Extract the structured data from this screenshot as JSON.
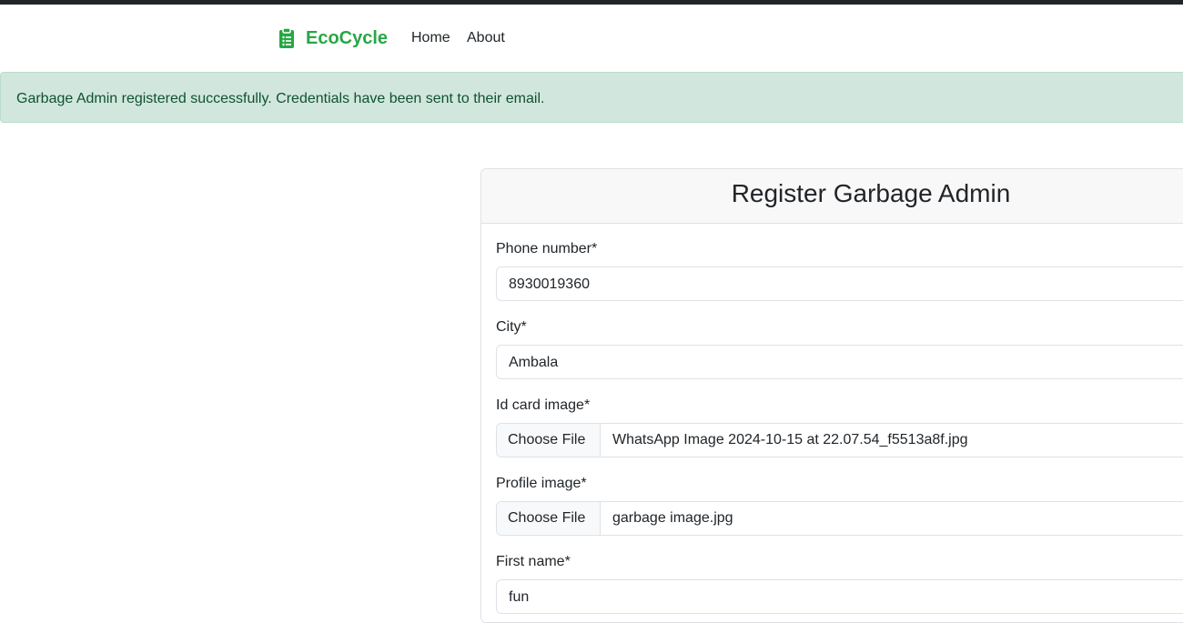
{
  "navbar": {
    "brand": "EcoCycle",
    "brand_icon": "clipboard-list-icon",
    "brand_color": "#28a745",
    "links": [
      {
        "label": "Home"
      },
      {
        "label": "About"
      }
    ]
  },
  "alert": {
    "message": "Garbage Admin registered successfully. Credentials have been sent to their email.",
    "background": "#d1e7dd",
    "text_color": "#0f5132"
  },
  "form": {
    "title": "Register Garbage Admin",
    "fields": {
      "phone": {
        "label": "Phone number*",
        "value": "8930019360"
      },
      "city": {
        "label": "City*",
        "value": "Ambala"
      },
      "id_card": {
        "label": "Id card image*",
        "button": "Choose File",
        "file": "WhatsApp Image 2024-10-15 at 22.07.54_f5513a8f.jpg"
      },
      "profile": {
        "label": "Profile image*",
        "button": "Choose File",
        "file": "garbage image.jpg"
      },
      "first_name": {
        "label": "First name*",
        "value": "fun"
      }
    }
  }
}
